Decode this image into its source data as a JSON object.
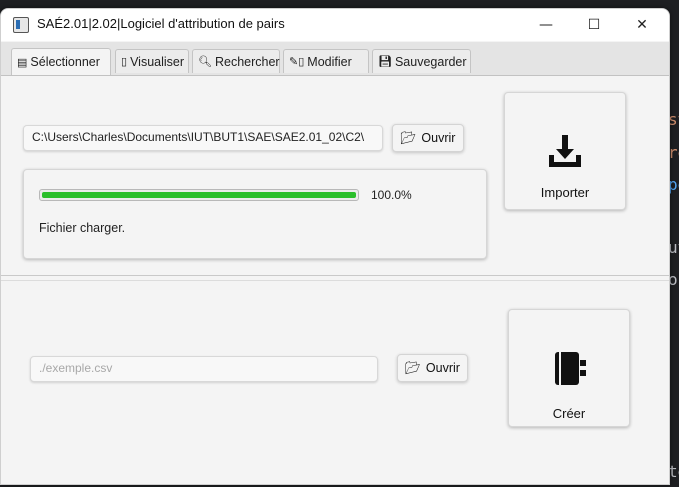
{
  "window": {
    "title": "SAÉ2.01|2.02|Logiciel d'attribution de pairs",
    "minimize_glyph": "—",
    "maximize_glyph": "☐",
    "close_glyph": "✕"
  },
  "tabs": [
    {
      "label": "Sélectionner",
      "icon": "file-icon",
      "active": true
    },
    {
      "label": "Visualiser",
      "icon": "table-icon",
      "active": false
    },
    {
      "label": "Rechercher",
      "icon": "search-icon",
      "active": false
    },
    {
      "label": "Modifier",
      "icon": "edit-icon",
      "active": false
    },
    {
      "label": "Sauvegarder",
      "icon": "save-icon",
      "active": false
    }
  ],
  "import_section": {
    "path_value": "C:\\Users\\Charles\\Documents\\IUT\\BUT1\\SAE\\SAE2.01_02\\C2\\",
    "open_label": "Ouvrir",
    "progress": 1.0,
    "progress_text": "100.0%",
    "status_text": "Fichier charger.",
    "import_label": "Importer"
  },
  "create_section": {
    "path_placeholder": "./exemple.csv",
    "open_label": "Ouvrir",
    "create_label": "Créer"
  },
  "colors": {
    "progress_fill": "#2bbf2b",
    "background_editor": "#1e1f22"
  }
}
